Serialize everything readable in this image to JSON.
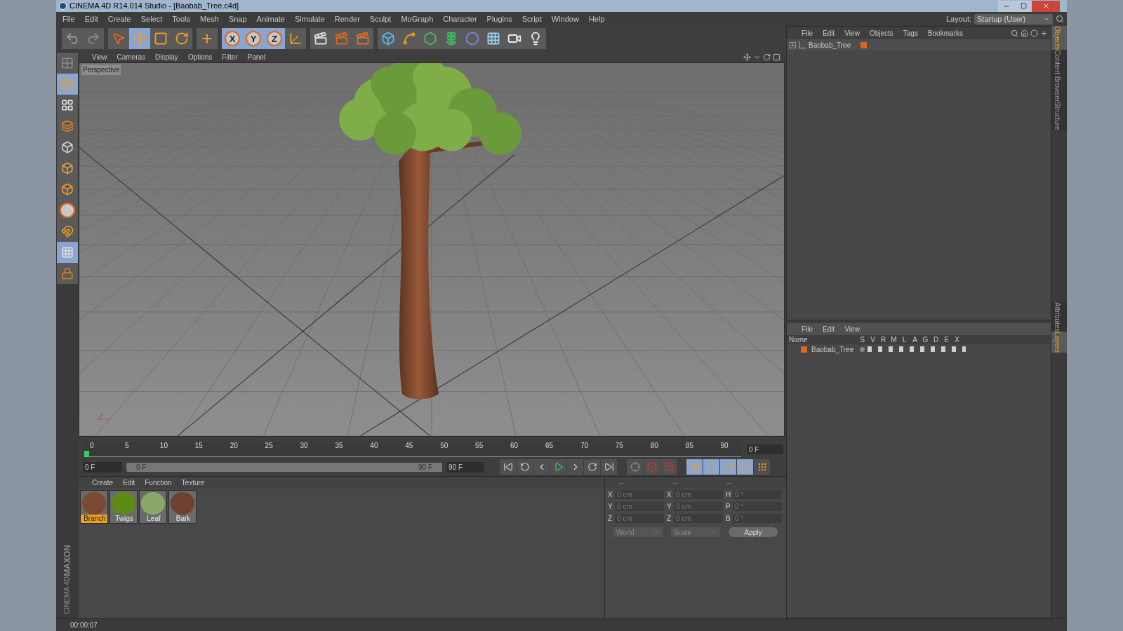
{
  "window": {
    "title": "CINEMA 4D R14.014 Studio - [Baobab_Tree.c4d]"
  },
  "menu": [
    "File",
    "Edit",
    "Create",
    "Select",
    "Tools",
    "Mesh",
    "Snap",
    "Animate",
    "Simulate",
    "Render",
    "Sculpt",
    "MoGraph",
    "Character",
    "Plugins",
    "Script",
    "Window",
    "Help"
  ],
  "layout": {
    "label": "Layout:",
    "value": "Startup (User)"
  },
  "toolbar": [
    [
      {
        "kind": "undo",
        "selected": false
      },
      {
        "kind": "redo",
        "selected": false
      }
    ],
    [
      {
        "kind": "select",
        "selected": false
      },
      {
        "kind": "move",
        "selected": true
      },
      {
        "kind": "scale",
        "selected": false
      },
      {
        "kind": "rotate",
        "selected": false
      }
    ],
    [
      {
        "kind": "add",
        "selected": false
      }
    ],
    [
      {
        "kind": "axis",
        "label": "X",
        "selected": true
      },
      {
        "kind": "axis",
        "label": "Y",
        "selected": true
      },
      {
        "kind": "axis",
        "label": "Z",
        "selected": true
      },
      {
        "kind": "coord",
        "selected": false
      }
    ],
    [
      {
        "kind": "render-view",
        "selected": false
      },
      {
        "kind": "render",
        "selected": false
      },
      {
        "kind": "render-settings",
        "selected": false
      }
    ],
    [
      {
        "kind": "cube",
        "selected": false
      },
      {
        "kind": "spline",
        "selected": false
      },
      {
        "kind": "nurbs",
        "selected": false
      },
      {
        "kind": "array",
        "selected": false
      },
      {
        "kind": "deformer",
        "selected": false
      },
      {
        "kind": "floor",
        "selected": false
      },
      {
        "kind": "camera",
        "selected": false
      },
      {
        "kind": "light",
        "selected": false
      }
    ]
  ],
  "left_tools": [
    {
      "kind": "editable",
      "selected": false
    },
    {
      "kind": "model",
      "selected": true
    },
    {
      "kind": "texture",
      "selected": false
    },
    {
      "kind": "workplane",
      "selected": false
    },
    {
      "kind": "points",
      "selected": false
    },
    {
      "kind": "edges",
      "selected": false
    },
    {
      "kind": "polygons",
      "selected": false
    },
    {
      "kind": "axis",
      "selected": false
    },
    {
      "kind": "magnet",
      "selected": false
    },
    {
      "kind": "snap",
      "selected": true
    },
    {
      "kind": "lock",
      "selected": false
    }
  ],
  "logo": {
    "brand": "MAXON",
    "product": "CINEMA 4D"
  },
  "viewport": {
    "menu": [
      "View",
      "Cameras",
      "Display",
      "Options",
      "Filter",
      "Panel"
    ],
    "camera": "Perspective"
  },
  "timeline": {
    "ticks": [
      "0",
      "5",
      "10",
      "15",
      "20",
      "25",
      "30",
      "35",
      "40",
      "45",
      "50",
      "55",
      "60",
      "65",
      "70",
      "75",
      "80",
      "85",
      "90"
    ],
    "playhead": {
      "level": 0
    },
    "current": "0 F",
    "start": "0 F",
    "range": {
      "start": "0 F",
      "end": "90 F",
      "level": 1
    },
    "end": "90 F"
  },
  "playback": [
    {
      "kind": "first"
    },
    {
      "kind": "prev-key"
    },
    {
      "kind": "prev-frame"
    },
    {
      "kind": "play"
    },
    {
      "kind": "next-frame"
    },
    {
      "kind": "next-key"
    },
    {
      "kind": "last"
    }
  ],
  "record": [
    {
      "kind": "motion"
    },
    {
      "kind": "record"
    },
    {
      "kind": "auto"
    }
  ],
  "key_tools": [
    {
      "kind": "move",
      "selected": true
    },
    {
      "kind": "scale",
      "selected": true
    },
    {
      "kind": "rotate",
      "selected": true
    },
    {
      "kind": "param",
      "selected": true
    },
    {
      "kind": "points",
      "selected": false
    }
  ],
  "materials": {
    "menu": [
      "Create",
      "Edit",
      "Function",
      "Texture"
    ],
    "items": [
      {
        "name": "Branch",
        "color": "#7a4a32",
        "selected": true
      },
      {
        "name": "Twigs",
        "color": "#5f8a16",
        "selected": false
      },
      {
        "name": "Leaf",
        "color": "#8aa86a",
        "selected": false
      },
      {
        "name": "Bark",
        "color": "#6e4030",
        "selected": false
      }
    ]
  },
  "coordinates": {
    "headers": [
      "--",
      "--",
      "--"
    ],
    "rows": [
      [
        {
          "label": "X",
          "value": "0 cm"
        },
        {
          "label": "X",
          "value": "0 cm"
        },
        {
          "label": "H",
          "value": "0 °"
        }
      ],
      [
        {
          "label": "Y",
          "value": "0 cm"
        },
        {
          "label": "Y",
          "value": "0 cm"
        },
        {
          "label": "P",
          "value": "0 °"
        }
      ],
      [
        {
          "label": "Z",
          "value": "0 cm"
        },
        {
          "label": "Z",
          "value": "0 cm"
        },
        {
          "label": "B",
          "value": "0 °"
        }
      ]
    ],
    "mode": "World",
    "scale": "Scale",
    "apply": "Apply"
  },
  "objects": {
    "menu": [
      "File",
      "Edit",
      "View",
      "Objects",
      "Tags",
      "Bookmarks"
    ],
    "items": [
      {
        "name": "Baobab_Tree",
        "expanded": false,
        "color": "#e0661e"
      }
    ]
  },
  "side_tabs_top": [
    {
      "label": "Objects",
      "selected": true
    },
    {
      "label": "Content Browser",
      "selected": false
    },
    {
      "label": "Structure",
      "selected": false
    }
  ],
  "layers": {
    "menu": [
      "File",
      "Edit",
      "View"
    ],
    "columns": [
      "Name",
      "S",
      "V",
      "R",
      "M",
      "L",
      "A",
      "G",
      "D",
      "E",
      "X"
    ],
    "items": [
      {
        "name": "Baobab_Tree",
        "color": "#e0661e"
      }
    ]
  },
  "side_tabs_bottom": [
    {
      "label": "Attributes",
      "selected": false
    },
    {
      "label": "Layers",
      "selected": true
    }
  ],
  "status_bar": {
    "time": "00:00:07"
  }
}
